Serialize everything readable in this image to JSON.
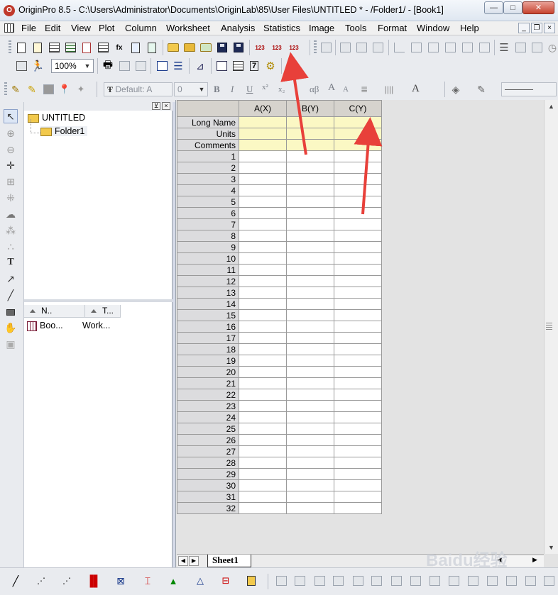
{
  "window": {
    "title": "OriginPro 8.5 - C:\\Users\\Administrator\\Documents\\OriginLab\\85\\User Files\\UNTITLED * - /Folder1/ - [Book1]",
    "min_glyph": "—",
    "max_glyph": "□",
    "close_glyph": "✕"
  },
  "menu": [
    "File",
    "Edit",
    "View",
    "Plot",
    "Column",
    "Worksheet",
    "Analysis",
    "Statistics",
    "Image",
    "Tools",
    "Format",
    "Window",
    "Help"
  ],
  "mdi": {
    "min": "_",
    "restore": "❐",
    "close": "×"
  },
  "toolbar": {
    "zoom": "100%",
    "font_name": "Default: A",
    "font_size": "0",
    "bold": "B",
    "italic": "I",
    "underline": "U",
    "superscript": "x²",
    "subscript": "x₂",
    "greek": "αβ",
    "increase_font": "A",
    "decrease_font": "A",
    "font_color": "A"
  },
  "explorer": {
    "root": "UNTITLED",
    "folder": "Folder1",
    "list_headers": [
      "N..",
      "T..."
    ],
    "list_items": [
      {
        "name": "Boo...",
        "type": "Work..."
      }
    ]
  },
  "worksheet": {
    "columns": [
      "A(X)",
      "B(Y)",
      "C(Y)"
    ],
    "attr_rows": [
      "Long Name",
      "Units",
      "Comments"
    ],
    "rows": [
      "1",
      "2",
      "3",
      "4",
      "5",
      "6",
      "7",
      "8",
      "9",
      "10",
      "11",
      "12",
      "13",
      "14",
      "15",
      "16",
      "17",
      "18",
      "19",
      "20",
      "21",
      "22",
      "23",
      "24",
      "25",
      "26",
      "27",
      "28",
      "29",
      "30",
      "31",
      "32"
    ],
    "sheet_tab": "Sheet1"
  },
  "colors": {
    "attr_row_bg": "#fbf8c4",
    "header_bg": "#d6d3cd",
    "annotation": "#e8403a"
  },
  "watermark": "Baidu经验"
}
